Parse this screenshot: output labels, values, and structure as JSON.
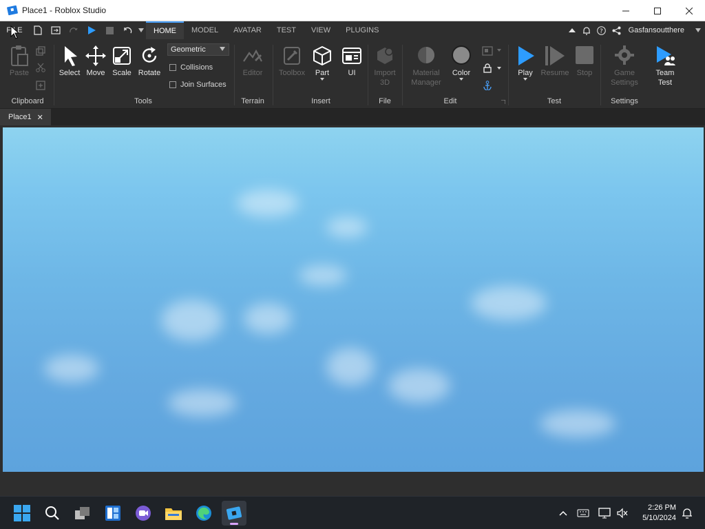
{
  "window": {
    "title": "Place1 - Roblox Studio"
  },
  "menubar": {
    "file_label": "FILE",
    "tabs": [
      {
        "label": "HOME",
        "active": true
      },
      {
        "label": "MODEL",
        "active": false
      },
      {
        "label": "AVATAR",
        "active": false
      },
      {
        "label": "TEST",
        "active": false
      },
      {
        "label": "VIEW",
        "active": false
      },
      {
        "label": "PLUGINS",
        "active": false
      }
    ],
    "username": "Gasfansoutthere"
  },
  "ribbon": {
    "clipboard": {
      "paste": "Paste",
      "group": "Clipboard"
    },
    "tools": {
      "select": "Select",
      "move": "Move",
      "scale": "Scale",
      "rotate": "Rotate",
      "mode": "Geometric",
      "collisions": "Collisions",
      "join_surfaces": "Join Surfaces",
      "group": "Tools"
    },
    "terrain": {
      "editor": "Editor",
      "group": "Terrain"
    },
    "insert": {
      "toolbox": "Toolbox",
      "part": "Part",
      "ui": "UI",
      "group": "Insert"
    },
    "file": {
      "import_line1": "Import",
      "import_line2": "3D",
      "group": "File"
    },
    "edit": {
      "material_line1": "Material",
      "material_line2": "Manager",
      "color": "Color",
      "group": "Edit"
    },
    "test": {
      "play": "Play",
      "resume": "Resume",
      "stop": "Stop",
      "group": "Test"
    },
    "settings": {
      "game_line1": "Game",
      "game_line2": "Settings",
      "team_line1": "Team",
      "team_line2": "Test",
      "group": "Settings"
    }
  },
  "doc_tabs": [
    {
      "label": "Place1",
      "close": "✕"
    }
  ],
  "taskbar": {
    "time": "2:26 PM",
    "date": "5/10/2024"
  },
  "colors": {
    "accent_blue": "#4aa3ff",
    "play_blue": "#2d9cff",
    "sky_top": "#8ed3ef",
    "sky_bottom": "#5da3dd"
  }
}
